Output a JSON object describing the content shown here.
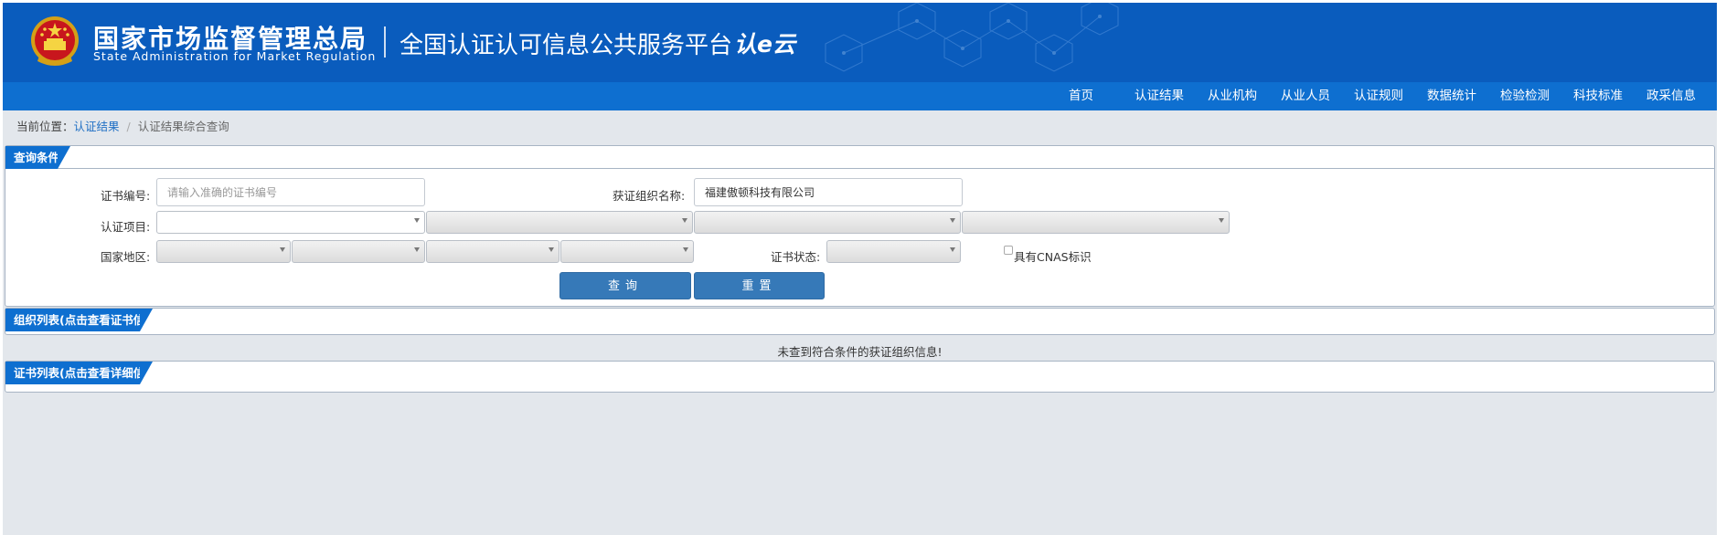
{
  "header": {
    "agency_cn": "国家市场监督管理总局",
    "agency_en": "State Administration  for  Market Regulation",
    "platform_title": "全国认证认可信息公共服务平台",
    "logo_text": "认e云"
  },
  "nav": {
    "items": [
      "首页",
      "认证结果",
      "从业机构",
      "从业人员",
      "认证规则",
      "数据统计",
      "检验检测",
      "科技标准",
      "政采信息"
    ]
  },
  "breadcrumb": {
    "prefix": "当前位置：",
    "link": "认证结果",
    "separator": "/",
    "current": "认证结果综合查询"
  },
  "query": {
    "title": "查询条件",
    "cert_no_label": "证书编号:",
    "cert_no_placeholder": "请输入准确的证书编号",
    "org_name_label": "获证组织名称:",
    "org_name_value": "福建傲顿科技有限公司",
    "project_label": "认证项目:",
    "region_label": "国家地区:",
    "status_label": "证书状态:",
    "cnas_label": "具有CNAS标识",
    "search_button": "查询",
    "reset_button": "重置"
  },
  "org_list": {
    "title": "组织列表(点击查看证书信息)",
    "empty_message": "未查到符合条件的获证组织信息!"
  },
  "cert_list": {
    "title": "证书列表(点击查看详细信息)"
  },
  "colors": {
    "header_bg": "#0a5cbd",
    "nav_bg": "#0e6fd0",
    "button_bg": "#3679b8",
    "page_bg": "#e3e7ec"
  }
}
